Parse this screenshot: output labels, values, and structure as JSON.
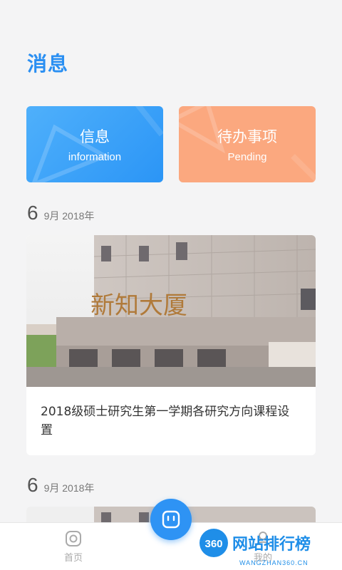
{
  "header": {
    "title": "消息"
  },
  "categories": [
    {
      "title": "信息",
      "subtitle": "information",
      "color": "#3ba3f8"
    },
    {
      "title": "待办事项",
      "subtitle": "Pending",
      "color": "#fba87f"
    }
  ],
  "feed": [
    {
      "day": "6",
      "month_year": "9月 2018年",
      "image_sign": "新知大厦",
      "title": "2018级硕士研究生第一学期各研究方向课程设置"
    },
    {
      "day": "6",
      "month_year": "9月 2018年"
    }
  ],
  "tabbar": {
    "home_label": "首页",
    "mine_label": "我的",
    "accent": "#2e93f4"
  },
  "watermark": {
    "badge": "360",
    "text": "网站排行榜",
    "url": "WANGZHAN360.CN"
  }
}
